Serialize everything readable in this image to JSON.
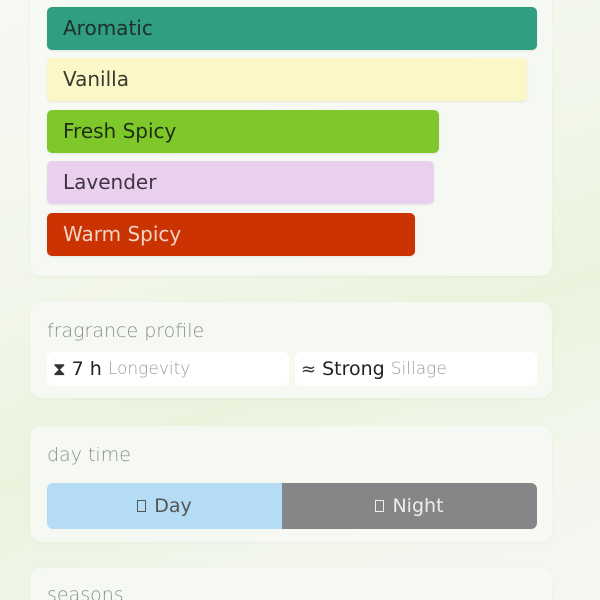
{
  "accords": [
    {
      "label": "Aromatic",
      "color": "#2f9e82",
      "text_color": "#1f2f2a",
      "strength": 1.0
    },
    {
      "label": "Vanilla",
      "color": "#fbf7c6",
      "text_color": "#3a3a30",
      "strength": 0.98
    },
    {
      "label": "Fresh Spicy",
      "color": "#7ec82c",
      "text_color": "#1f2f12",
      "strength": 0.8
    },
    {
      "label": "Lavender",
      "color": "#e8d0ee",
      "text_color": "#3d3640",
      "strength": 0.79
    },
    {
      "label": "Warm Spicy",
      "color": "#cc3302",
      "text_color": "#f3d3c3",
      "strength": 0.75
    }
  ],
  "profile": {
    "title": "fragrance profile",
    "longevity": {
      "icon": "hourglass-icon",
      "value": "7 h",
      "label": "Longevity"
    },
    "sillage": {
      "icon": "waves-icon",
      "value": "Strong",
      "label": "Sillage"
    }
  },
  "daytime": {
    "title": "day time",
    "day": {
      "label": "Day",
      "color": "#b5dcf5",
      "text_color": "#555"
    },
    "night": {
      "label": "Night",
      "color": "#858687",
      "text_color": "#eeeeee"
    }
  },
  "seasons": {
    "title": "seasons"
  }
}
